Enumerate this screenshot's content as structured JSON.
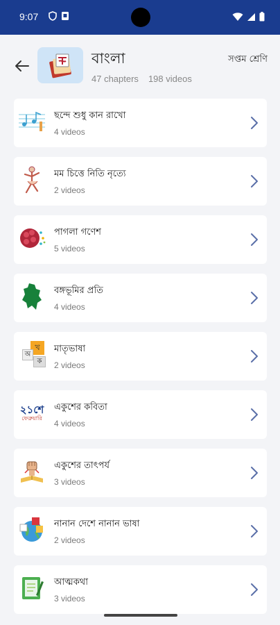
{
  "status_bar": {
    "time": "9:07"
  },
  "header": {
    "title": "বাংলা",
    "chapters": "47 chapters",
    "videos": "198 videos",
    "class_label": "সপ্তম শ্রেণি"
  },
  "chapters": [
    {
      "title": "ছন্দে শুধু কান রাখো",
      "count": "4 videos",
      "icon": "music-notes-icon"
    },
    {
      "title": "মম চিত্তে নিতি নৃত্যে",
      "count": "2 videos",
      "icon": "dancer-icon"
    },
    {
      "title": "পাগলা গণেশ",
      "count": "5 videos",
      "icon": "brain-icon"
    },
    {
      "title": "বঙ্গভূমির প্রতি",
      "count": "4 videos",
      "icon": "map-icon"
    },
    {
      "title": "মাতৃভাষা",
      "count": "2 videos",
      "icon": "letter-blocks-icon"
    },
    {
      "title": "একুশের কবিতা",
      "count": "4 videos",
      "icon": "ekushe-text-icon"
    },
    {
      "title": "একুশের তাৎপর্য",
      "count": "3 videos",
      "icon": "raised-fist-icon"
    },
    {
      "title": "নানান দেশে নানান ভাষা",
      "count": "2 videos",
      "icon": "globe-languages-icon"
    },
    {
      "title": "আত্মকথা",
      "count": "3 videos",
      "icon": "notebook-icon"
    }
  ],
  "icon_badge_text": {
    "ekushe_top": "২১শে",
    "ekushe_bottom": "ফেব্রুয়ারি",
    "block_a": "অ",
    "block_b": "ক",
    "block_c": "খ"
  },
  "colors": {
    "status_bar": "#1a3c8f",
    "background": "#f3f4f7",
    "chevron": "#5a6fa8",
    "thumb_bg": "#cfe4f7"
  }
}
